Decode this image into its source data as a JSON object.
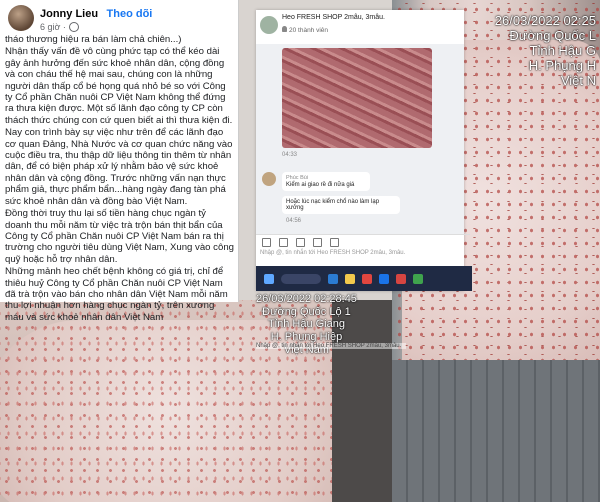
{
  "post": {
    "author": "Jonny Lieu",
    "follow": "Theo dõi",
    "time": "6 giờ ·",
    "paragraphs": [
      "tháo thương hiệu ra bán làm chả chiên...)",
      "Nhận thấy vấn đề vô cùng phức tạp có thể kéo dài gây ảnh hưởng đến sức khoẻ nhân dân, cộng đồng và con cháu thế hệ mai sau, chúng con là những người dân thấp cổ bé họng quá nhỏ bé so với Công ty Cổ phần Chăn nuôi CP Việt Nam không thể đứng ra thưa kiện được. Một số lãnh đạo công ty CP còn thách thức chúng con cứ quen biết ai thì thưa kiện đi.",
      "Nay con trình bày sự việc như trên để các lãnh đạo cơ quan Đảng, Nhà Nước và cơ quan chức năng vào cuộc điều tra, thu thập dữ liệu thông tin thêm từ nhân dân, để có biện pháp xử lý nhằm bảo vệ sức khoẻ nhân dân và cộng đồng. Trước những vấn nạn thực phẩm giả, thực phẩm bẩn...hàng ngày đang tàn phá sức khoẻ nhân dân và đồng bào Việt Nam.",
      "Đồng thời truy thu lại số tiền hàng chục ngàn tỷ doanh thu mỗi năm từ việc trà trộn bán thịt bẩn của Công ty Cổ phần Chăn nuôi CP Việt Nam bán ra thị trường cho người tiêu dùng Việt Nam, Xung vào công quỹ hoặc hỗ trợ nhân dân.",
      "Những mảnh heo chết bệnh không có giá trị, chỉ để thiêu huỷ Công ty Cổ phần Chăn nuôi CP Việt Nam đã trà trộn vào bán cho nhân dân Việt Nam mỗi năm thu lợi nhuận hơn hàng chục ngàn tỷ, trên xương máu và sức khoẻ nhân dân Việt Nam"
    ]
  },
  "chat": {
    "title": "Heo FRESH SHOP 2mâu, 3mâu.",
    "members": "20 thành viên",
    "time1": "04:33",
    "sender": "Phúc Bùi",
    "msg1": "Kiểm ai giao rề đi nữa giá",
    "msg2": "Hoặc lúc nạc kiểm chổ nào làm lạp xưởng",
    "time2": "04:56",
    "composer": "Nhập @, tin nhắn tới Heo FRESH SHOP 2mâu, 3mâu.",
    "composer_overlay": "Nhập @, tin nhắn tới Heo FRESH SHOP 2mâu, 3mâu."
  },
  "stamp_right": {
    "time": "26/03/2022 02:25",
    "road": "Đường Quốc L",
    "province": "Tỉnh Hậu G",
    "town": "H. Phụng H",
    "country": "Việt N"
  },
  "stamp_bottom": {
    "time": "26/03/2022 02:28:45",
    "road": "Đường Quốc Lộ 1",
    "province": "Tỉnh Hậu Giang",
    "town": "H. Phụng Hiệp",
    "country": "Việt Nam"
  },
  "colors": {
    "facebook_blue": "#1877f2",
    "taskbar": "#1f2a44"
  }
}
